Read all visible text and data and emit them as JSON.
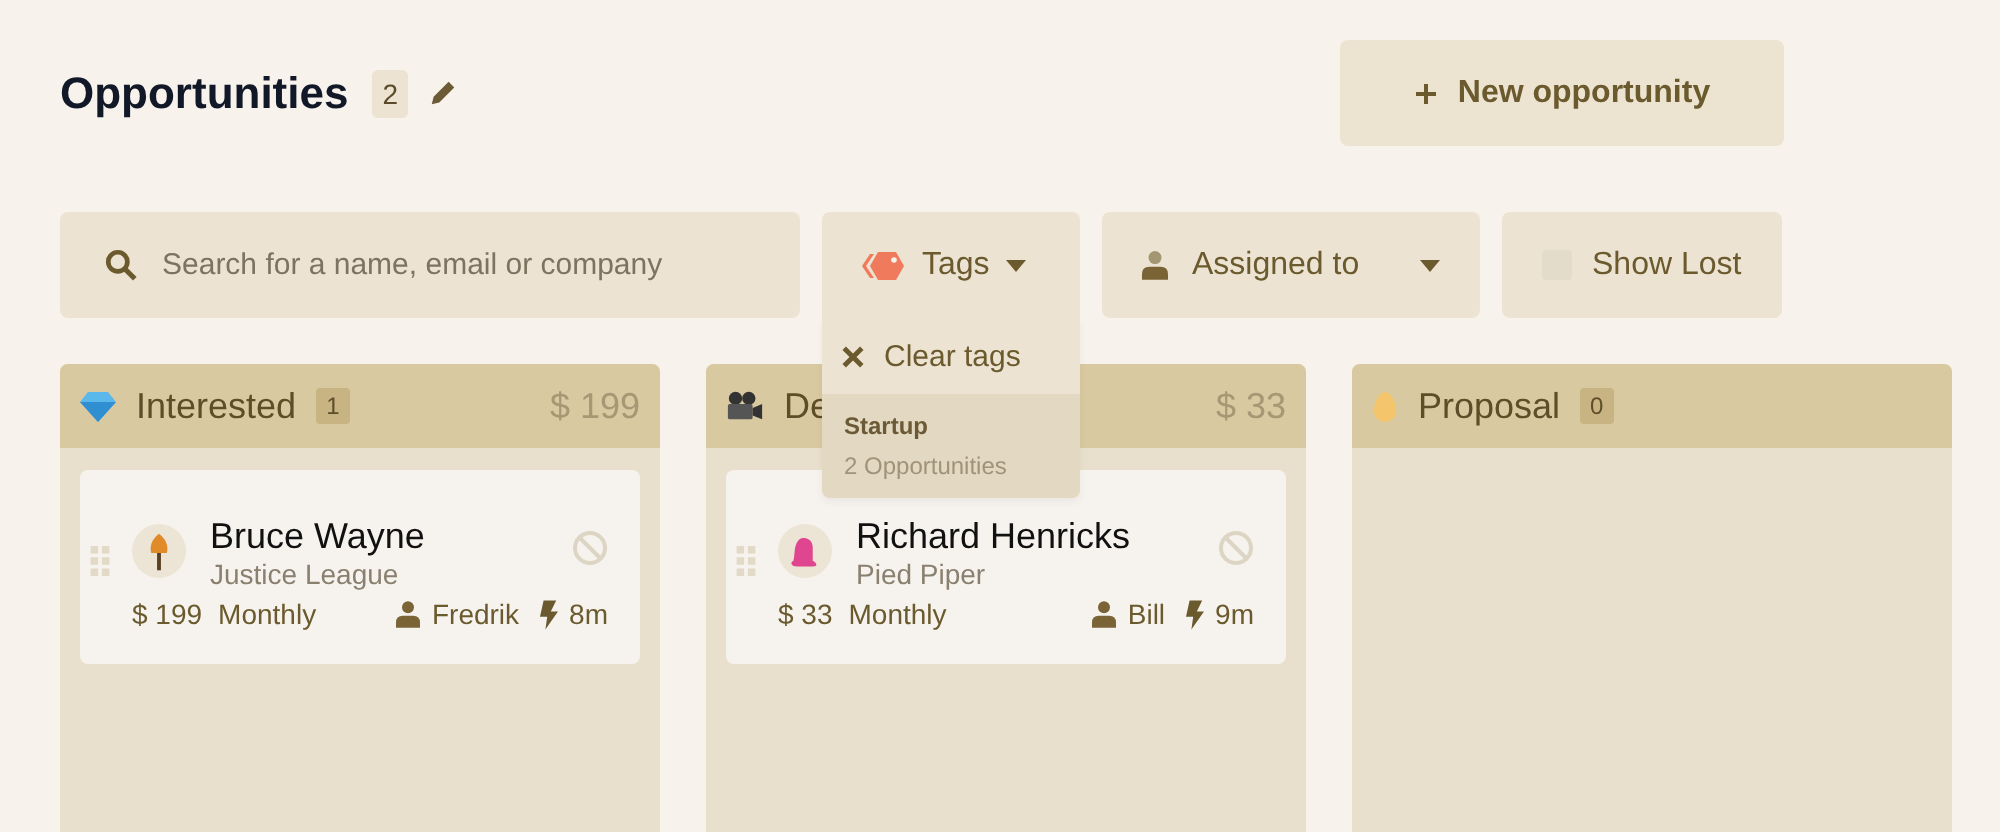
{
  "header": {
    "title": "Opportunities",
    "count": "2",
    "new_button": "New opportunity"
  },
  "filters": {
    "search": {
      "placeholder": "Search for a name, email or company"
    },
    "tags": {
      "label": "Tags",
      "expanded": true,
      "menu": {
        "clear": "Clear tags",
        "items": [
          {
            "name": "Startup",
            "count": "2 Opportunities"
          }
        ]
      }
    },
    "assigned": {
      "label": "Assigned to"
    },
    "show_lost": {
      "label": "Show Lost",
      "checked": false
    }
  },
  "columns": [
    {
      "kind": "gem",
      "title": "Interested",
      "count": "1",
      "total": "$ 199",
      "cards": [
        {
          "kind": "tree",
          "name": "Bruce Wayne",
          "company": "Justice League",
          "amount": "$ 199",
          "period": "Monthly",
          "owner": "Fredrik",
          "age": "8m"
        }
      ]
    },
    {
      "kind": "camera",
      "title": "De",
      "total": "$ 33",
      "cards": [
        {
          "kind": "blob",
          "name": "Richard Henricks",
          "company": "Pied Piper",
          "amount": "$ 33",
          "period": "Monthly",
          "owner": "Bill",
          "age": "9m"
        }
      ]
    },
    {
      "kind": "egg",
      "title": "Proposal",
      "count": "0"
    }
  ]
}
